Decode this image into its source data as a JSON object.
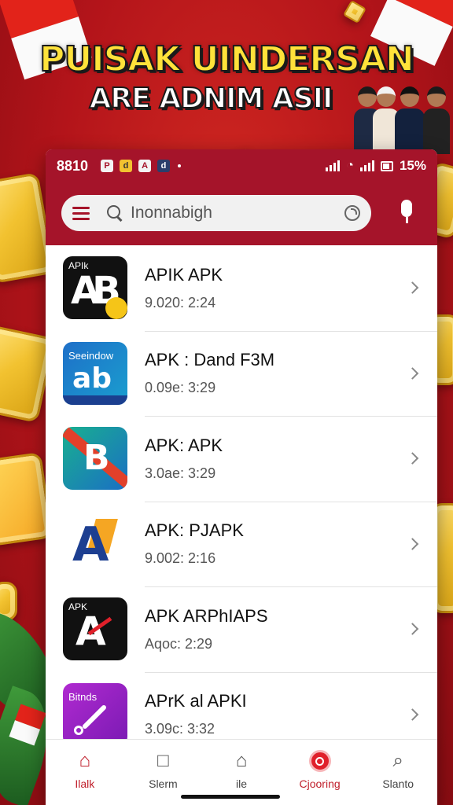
{
  "banner": {
    "title_line1": "PUISAK UINDERSAN",
    "title_line2": "ARE ADNIM ASII"
  },
  "status_bar": {
    "time": "8810",
    "notification_icons": [
      "P",
      "d",
      "A",
      "d"
    ],
    "battery_text": "15%"
  },
  "search": {
    "value": "Inonnabigh"
  },
  "apps": [
    {
      "title": "APIK APK",
      "meta": "9.020: 2:24",
      "icon_small": "APIk",
      "icon_big": "AB",
      "icon_bg": "#111111",
      "icon_fg": "#e0202a"
    },
    {
      "title": "APK : Dand F3M",
      "meta": "0.09e: 3:29",
      "icon_small": "Seeindow",
      "icon_big": "ab",
      "icon_bg": "#1e6fc8",
      "icon_fg": "#ffffff"
    },
    {
      "title": "APK: APK",
      "meta": "3.0ae: 3:29",
      "icon_small": "",
      "icon_big": "B",
      "icon_bg": "#1aa29a",
      "icon_fg": "#ffffff"
    },
    {
      "title": "APK: PJAPK",
      "meta": "9.002: 2:16",
      "icon_small": "",
      "icon_big": "A",
      "icon_bg": "#ffffff",
      "icon_fg": "#1d3f91"
    },
    {
      "title": "APK ARPhIAPS",
      "meta": "Aqoc: 2:29",
      "icon_small": "APK",
      "icon_big": "A",
      "icon_bg": "#111111",
      "icon_fg": "#e0202a"
    },
    {
      "title": "APrK al APKI",
      "meta": "3.09c: 3:32",
      "icon_small": "Bitnds",
      "icon_big": "∕",
      "icon_bg": "#9b22c8",
      "icon_fg": "#ffffff"
    }
  ],
  "bottom_nav": [
    {
      "label": "Ilalk",
      "icon": "home-red-icon"
    },
    {
      "label": "Slerm",
      "icon": "folder-icon"
    },
    {
      "label": "ile",
      "icon": "house-icon"
    },
    {
      "label": "Cjooring",
      "icon": "record-icon"
    },
    {
      "label": "Slanto",
      "icon": "search-icon"
    }
  ],
  "colors": {
    "background_red": "#b3141a",
    "header_red": "#a5142a",
    "title_yellow": "#ffe23a",
    "accent": "#c0202c"
  }
}
